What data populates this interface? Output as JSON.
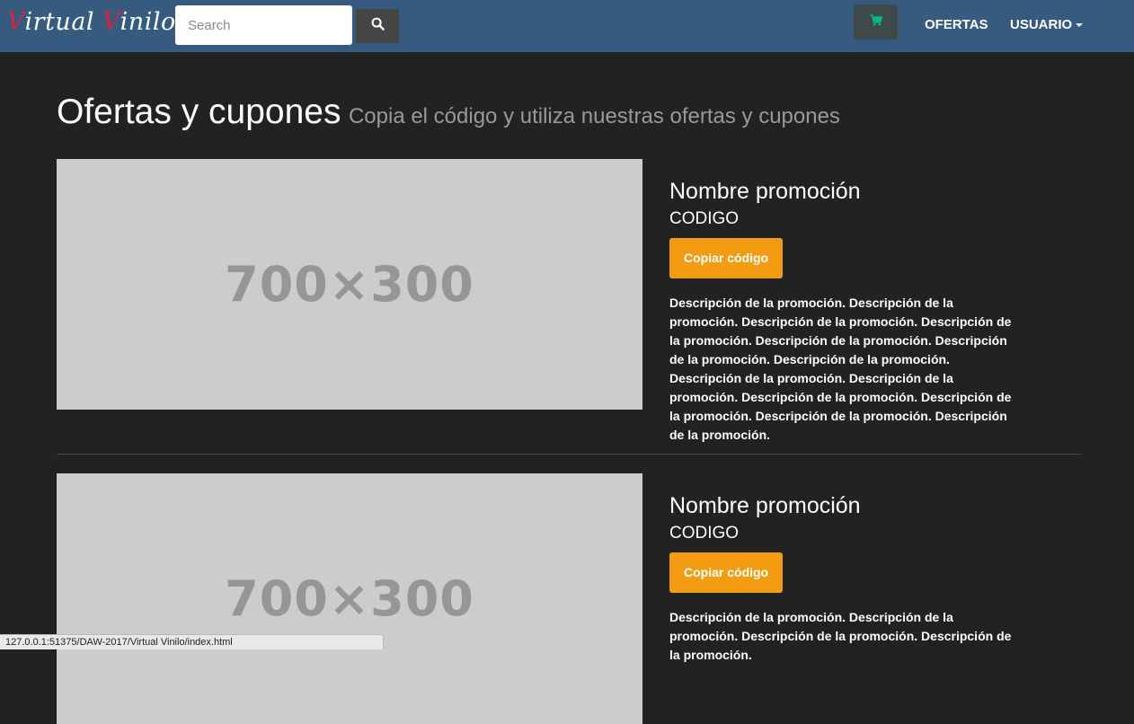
{
  "navbar": {
    "brand_part1": "V",
    "brand_part2": "irtual ",
    "brand_part3": "V",
    "brand_part4": "inilo",
    "search_placeholder": "Search",
    "search_icon": "search-icon",
    "cart_icon": "cart-icon",
    "links": [
      {
        "label": "OFERTAS"
      },
      {
        "label": "USUARIO"
      }
    ],
    "colors": {
      "bar": "#375a7f",
      "brand_accent": "#e0203c",
      "cart_icon": "#00bc8c"
    }
  },
  "header": {
    "title": "Ofertas y cupones",
    "subtitle": "Copia el código y utiliza nuestras ofertas y cupones"
  },
  "promotions": [
    {
      "image_text": "700×300",
      "name": "Nombre promoción",
      "code": "CODIGO",
      "button_label": "Copiar código",
      "description": "Descripción de la promoción. Descripción de la promoción. Descripción de la promoción. Descripción de la promoción. Descripción de la promoción. Descripción de la promoción. Descripción de la promoción. Descripción de la promoción. Descripción de la promoción. Descripción de la promoción. Descripción de la promoción. Descripción de la promoción. Descripción de la promoción."
    },
    {
      "image_text": "700×300",
      "name": "Nombre promoción",
      "code": "CODIGO",
      "button_label": "Copiar código",
      "description": "Descripción de la promoción. Descripción de la promoción. Descripción de la promoción. Descripción de la promoción."
    }
  ],
  "status_bar": {
    "url": "127.0.0.1:51375/DAW-2017/Virtual Vinilo/index.html"
  },
  "colors": {
    "background": "#222222",
    "button": "#f39c12",
    "placeholder": "#cccccc"
  }
}
